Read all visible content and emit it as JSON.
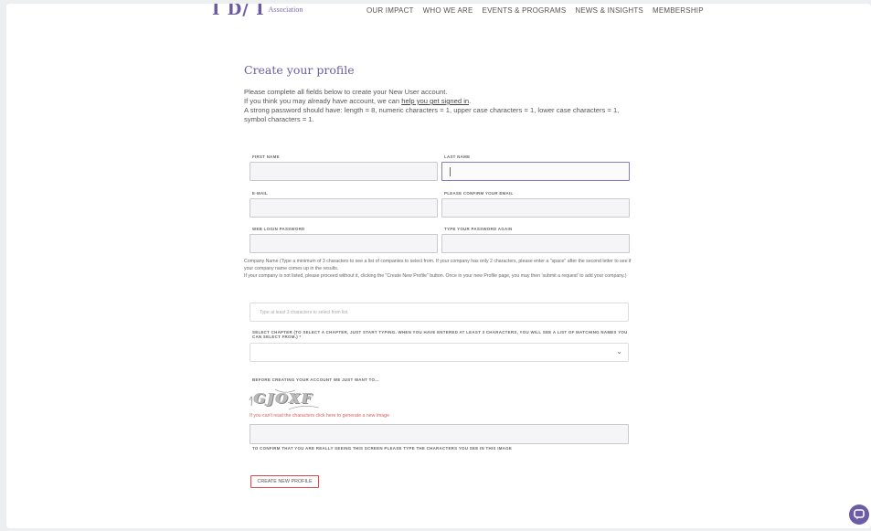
{
  "header": {
    "logo_mark": "I D/ I",
    "logo_text": "Association",
    "nav": [
      "OUR IMPACT",
      "WHO WE ARE",
      "EVENTS & PROGRAMS",
      "NEWS & INSIGHTS",
      "MEMBERSHIP"
    ]
  },
  "form": {
    "title": "Create your profile",
    "intro": {
      "line1": "Please complete all fields below to create your New User account.",
      "line2_prefix": "If you think you may already have account, we can ",
      "line2_link": "help you get signed in",
      "line2_suffix": ".",
      "line3": "A strong password should have: length = 8, numeric characters = 1, upper case characters = 1, lower case characters = 1, symbol characters = 1."
    },
    "labels": {
      "first_name": "FIRST NAME",
      "last_name": "LAST NAME",
      "email": "E-MAIL",
      "confirm_email": "PLEASE CONFIRM YOUR EMAIL",
      "password": "WEB LOGIN PASSWORD",
      "password_again": "TYPE YOUR PASSWORD AGAIN",
      "chapter": "SELECT CHAPTER (TO SELECT A CHAPTER, JUST START TYPING. WHEN YOU HAVE ENTERED AT LEAST 3 CHARACTERS, YOU WILL SEE A LIST OF MATCHING NAMES YOU CAN SELECT FROM.) *",
      "captcha_heading": "BEFORE CREATING YOUR ACCOUNT WE JUST WANT TO...",
      "captcha_confirm": "TO CONFIRM THAT YOU ARE REALLY SEEING THIS SCREEN PLEASE TYPE THE CHARACTERS YOU SEE IN THIS IMAGE"
    },
    "company_help": {
      "line1": "Company Name (Type a minimum of 3 characters to see a list of companies to select from. If your company has only 2 characters, please enter a \"space\" after the second letter to see if your company name comes up in the results.",
      "line2": "If your company is not listed, please proceed without it, clicking the \"Create New Profile\" button. Once in your new Profile page, you may then 'submit a request' to add your company.)"
    },
    "company_placeholder": "Type at least 3 characters to select from list.",
    "chapter_selected": "",
    "captcha_text": "GJOXF",
    "regen_link": "If you can't read the characters click here to generate a new image",
    "submit_label": "CREATE NEW PROFILE"
  },
  "colors": {
    "accent": "#6b5ca5",
    "error_link": "#e05c5c",
    "submit_border": "#d94a4a"
  },
  "icons": {
    "chat": "chat-bubble-icon",
    "select": "chevron-down-icon"
  }
}
